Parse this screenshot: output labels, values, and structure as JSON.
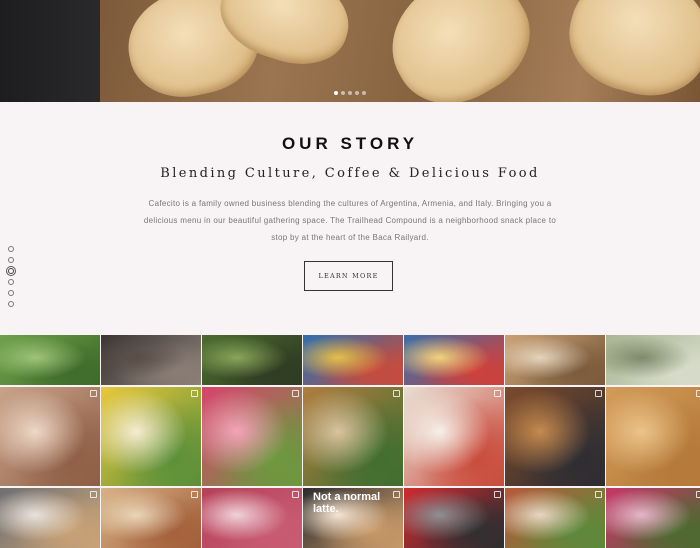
{
  "hero": {
    "slides": 5,
    "active_slide": 1
  },
  "story": {
    "title": "OUR STORY",
    "subtitle": "Blending Culture, Coffee & Delicious Food",
    "body": "Cafecito is a family owned business blending the cultures of Argentina, Armenia, and Italy. Bringing you a delicious menu in our beautiful gathering space. The Trailhead Compound is a neighborhood snack place to stop by at the heart of the Baca Railyard.",
    "button_label": "LEARN MORE"
  },
  "side_nav": {
    "count": 6,
    "active_index": 2
  },
  "gallery": {
    "rows": [
      [
        {
          "name": "people-on-grass-photo",
          "colors": [
            "#6fa24a",
            "#3f6b2a",
            "#9ec47a"
          ]
        },
        {
          "name": "patio-seating-photo",
          "colors": [
            "#3a3533",
            "#8c7f77",
            "#5a4d47"
          ]
        },
        {
          "name": "garden-fence-photo",
          "colors": [
            "#4c6b2f",
            "#2e3b22",
            "#8aa55a"
          ]
        },
        {
          "name": "colorful-storefront-photo",
          "colors": [
            "#2f6fae",
            "#c94b3b",
            "#e2c04a"
          ]
        },
        {
          "name": "mural-wall-photo",
          "colors": [
            "#3b6fa8",
            "#d0403a",
            "#f1d27a"
          ]
        },
        {
          "name": "sandwich-plate-photo",
          "colors": [
            "#caa276",
            "#7a5a3b",
            "#e6d4bd"
          ]
        },
        {
          "name": "heart-cookie-photo",
          "colors": [
            "#a9b693",
            "#d9dccb",
            "#7d8a6a"
          ]
        }
      ],
      [
        {
          "name": "coffee-cup-hand-photo",
          "colors": [
            "#c9a38a",
            "#8f5e45",
            "#eed8c8"
          ]
        },
        {
          "name": "egg-scramble-plate-photo",
          "colors": [
            "#e8c83a",
            "#5b8f3a",
            "#f6ecd0"
          ]
        },
        {
          "name": "pink-tulip-photo",
          "colors": [
            "#d8436e",
            "#6a9a3e",
            "#f3a3b8"
          ]
        },
        {
          "name": "crusted-chicken-plate-photo",
          "colors": [
            "#b07d3f",
            "#3f6e2f",
            "#d9c3a0"
          ]
        },
        {
          "name": "gnocchi-dough-photo",
          "colors": [
            "#e9dfd4",
            "#c94a3a",
            "#f6f1ea"
          ]
        },
        {
          "name": "burger-photo",
          "colors": [
            "#7c4a2b",
            "#2d2d33",
            "#c68a4e"
          ]
        },
        {
          "name": "empanada-tray-photo",
          "colors": [
            "#d39b58",
            "#b47838",
            "#ecc48b"
          ]
        }
      ],
      [
        {
          "name": "dessert-slice-photo",
          "colors": [
            "#6f6f72",
            "#c9a276",
            "#e8e2dc"
          ]
        },
        {
          "name": "single-empanada-photo",
          "colors": [
            "#d7b287",
            "#a35f3a",
            "#ead5b7"
          ]
        },
        {
          "name": "line-art-figure-photo",
          "colors": [
            "#b5415a",
            "#c85c72",
            "#f0d2d8"
          ]
        },
        {
          "name": "latte-art-photo",
          "caption": "Not a normal latte.",
          "colors": [
            "#2b2b2d",
            "#c99a6a",
            "#f3e4d2"
          ]
        },
        {
          "name": "cafe-counter-photo",
          "colors": [
            "#d02a2f",
            "#2e2e30",
            "#8f8f93"
          ]
        },
        {
          "name": "avocado-toast-photo",
          "colors": [
            "#b8593a",
            "#5b8a3a",
            "#e7d6c2"
          ]
        },
        {
          "name": "flowers-photo",
          "colors": [
            "#c8366a",
            "#4a6b2f",
            "#e6b6c9"
          ]
        }
      ]
    ]
  }
}
